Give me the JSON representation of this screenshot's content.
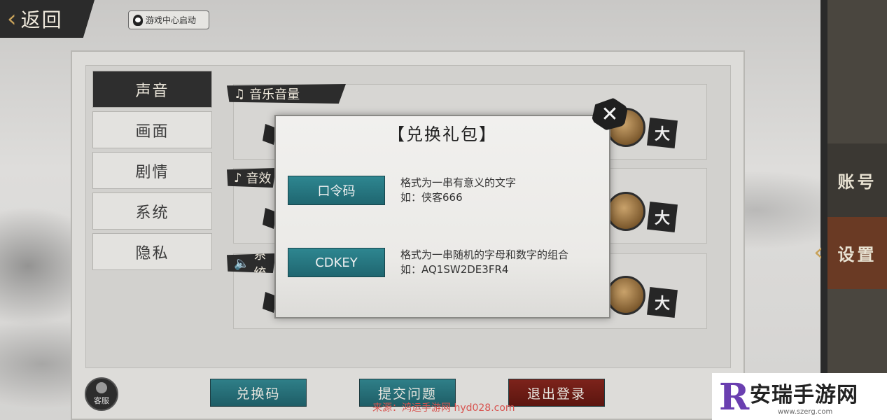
{
  "header": {
    "back_label": "返回",
    "game_center_label": "游戏中心启动"
  },
  "sidebar": {
    "items": [
      {
        "label": "声音",
        "active": true
      },
      {
        "label": "画面",
        "active": false
      },
      {
        "label": "剧情",
        "active": false
      },
      {
        "label": "系统",
        "active": false
      },
      {
        "label": "隐私",
        "active": false
      }
    ]
  },
  "sections": [
    {
      "label": "音乐音量",
      "icon": "music-note-icon",
      "max_label": "大"
    },
    {
      "label": "音效",
      "icon": "note-icon",
      "max_label": "大"
    },
    {
      "label": "系统",
      "icon": "speaker-icon",
      "max_label": "大"
    }
  ],
  "right_tabs": {
    "account_label": "账号",
    "settings_label": "设置"
  },
  "bottom": {
    "redeem_label": "兑换码",
    "feedback_label": "提交问题",
    "logout_label": "退出登录",
    "service_label": "客服"
  },
  "modal": {
    "title": "【兑换礼包】",
    "options": [
      {
        "button": "口令码",
        "desc1": "格式为一串有意义的文字",
        "desc2": "如：侠客666"
      },
      {
        "button": "CDKEY",
        "desc1": "格式为一串随机的字母和数字的组合",
        "desc2": "如：AQ1SW2DE3FR4"
      }
    ]
  },
  "watermark": "来源：鸿运手游网 hyd028.com",
  "brand": {
    "name": "安瑞手游网",
    "url": "www.szerg.com"
  },
  "colors": {
    "accent_teal": "#2e8690",
    "danger_red": "#7d231b",
    "gold": "#c8a25a"
  }
}
